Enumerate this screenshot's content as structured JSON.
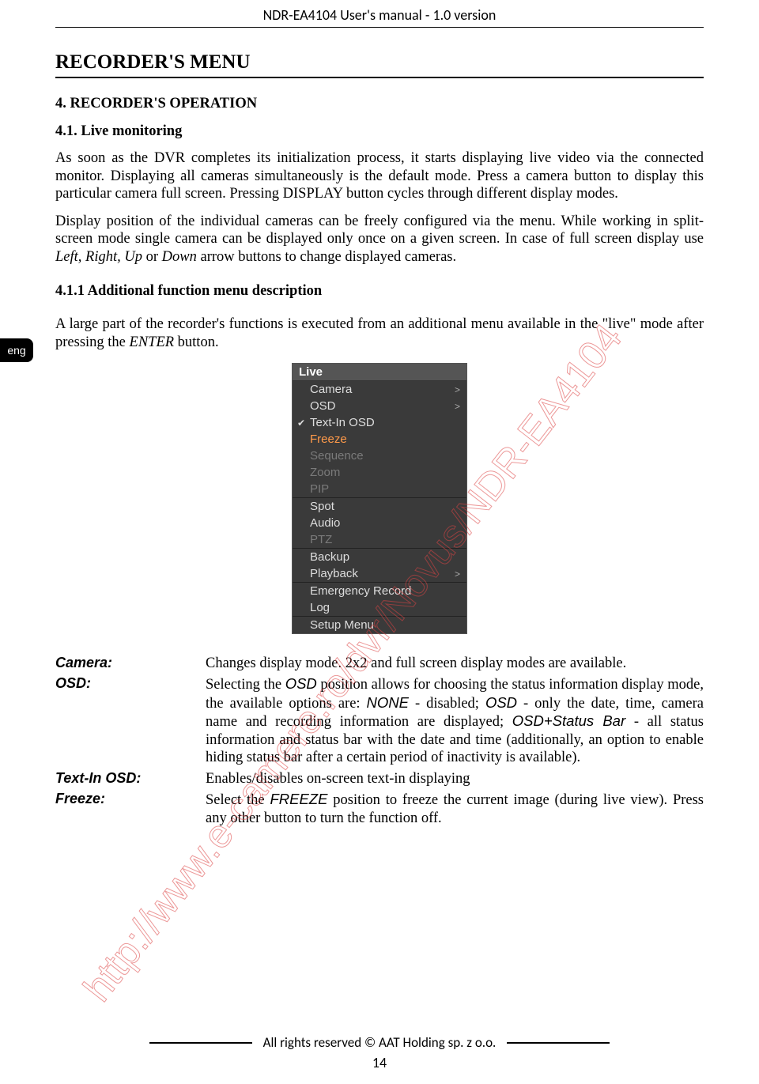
{
  "header": "NDR-EA4104 User's manual - 1.0 version",
  "lang_tab": "eng",
  "section_title": "RECORDER'S MENU",
  "h_4": "4.     RECORDER'S OPERATION",
  "h_41": "4.1.   Live monitoring",
  "para_1": "As soon as the DVR completes its initialization process, it starts displaying live video via the connected monitor. Displaying all cameras simultaneously is the default mode. Press a camera button to display this particular camera full screen. Pressing DISPLAY button cycles through different display modes.",
  "para_2a": "Display position of the individual cameras can be freely configured via the menu. While working in split-screen mode single camera can be displayed only once on a given screen. In case of full screen display use ",
  "para_2b": "Left, Right, Up",
  "para_2c": " or ",
  "para_2d": "Down",
  "para_2e": " arrow buttons  to change displayed cameras.",
  "h_411": "4.1.1 Additional function menu description",
  "para_3a": "A large part of the recorder's functions is executed from an additional menu available in the \"live\" mode after pressing the ",
  "para_3b": "ENTER",
  "para_3c": " button.",
  "menu": {
    "title": "Live",
    "items": [
      {
        "label": "Camera",
        "arrow": true
      },
      {
        "label": "OSD",
        "arrow": true
      },
      {
        "label": "Text-In OSD",
        "check": true
      },
      {
        "label": "Freeze",
        "highlight": true
      },
      {
        "label": "Sequence",
        "disabled": true
      },
      {
        "label": "Zoom",
        "disabled": true
      },
      {
        "label": "PIP",
        "disabled": true
      },
      {
        "label": "Spot",
        "sep": true
      },
      {
        "label": "Audio"
      },
      {
        "label": "PTZ",
        "disabled": true
      },
      {
        "label": "Backup",
        "sep": true
      },
      {
        "label": "Playback",
        "arrow": true
      },
      {
        "label": "Emergency Record",
        "sep": true
      },
      {
        "label": "Log"
      },
      {
        "label": "Setup Menu",
        "sep": true
      }
    ]
  },
  "defs": {
    "camera": {
      "term": "Camera:",
      "desc": "Changes display mode. 2x2 and full screen display modes are available."
    },
    "osd": {
      "term": "OSD:",
      "d1": "Selecting the ",
      "d2": "OSD",
      "d3": " position allows for choosing the status information display mode, the available options are: ",
      "d4": "NONE",
      "d5": " - disabled; ",
      "d6": "OSD",
      "d7": " -  only the date, time, camera name and recording information are displayed; ",
      "d8": "OSD+Status Bar",
      "d9": " - all status information and status bar with the date and time (additionally, an option to enable hiding status bar after a certain period of inactivity is available)."
    },
    "textin": {
      "term": "Text-In OSD:",
      "desc": "Enables/disables on-screen text-in displaying"
    },
    "freeze": {
      "term": "Freeze:",
      "d1": "Select the ",
      "d2": "FREEZE",
      "d3": " position to freeze the current image (during live view). Press any other button to turn the function off."
    }
  },
  "footer": "All rights reserved © AAT Holding sp. z o.o.",
  "page_number": "14",
  "watermark": "http://www.e-camere.ro/dvr/Novus/NDR-EA4104"
}
